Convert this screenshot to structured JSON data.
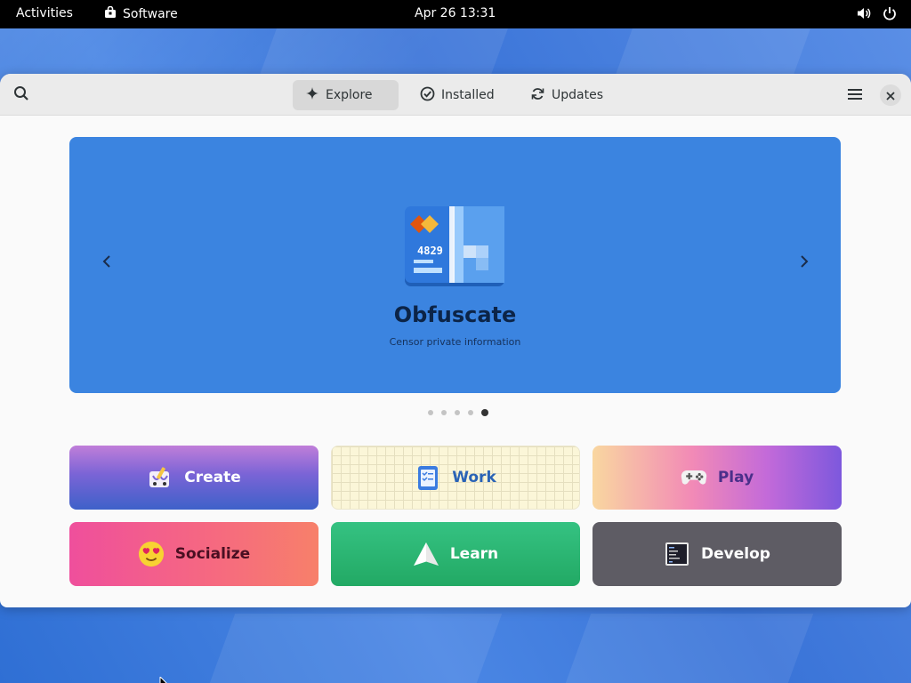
{
  "topbar": {
    "activities": "Activities",
    "app_name": "Software",
    "clock": "Apr 26  13:31",
    "icons": [
      "volume-icon",
      "power-icon"
    ]
  },
  "headerbar": {
    "tabs": [
      {
        "label": "Explore",
        "icon": "sparkle-icon",
        "active": true
      },
      {
        "label": "Installed",
        "icon": "check-circle-icon",
        "active": false
      },
      {
        "label": "Updates",
        "icon": "refresh-icon",
        "active": false
      }
    ],
    "icons": [
      "search-icon",
      "hamburger-menu-icon",
      "close-icon"
    ]
  },
  "banner": {
    "app_name": "Obfuscate",
    "app_description": "Censor private information",
    "icon_text": "4829",
    "background": "#3b84e0",
    "carousel": {
      "pages": 5,
      "active_page": 5
    }
  },
  "categories": [
    {
      "label": "Create",
      "icon": "create-icon"
    },
    {
      "label": "Work",
      "icon": "work-icon"
    },
    {
      "label": "Play",
      "icon": "gamepad-icon"
    },
    {
      "label": "Socialize",
      "icon": "emoji-icon"
    },
    {
      "label": "Learn",
      "icon": "paper-plane-icon"
    },
    {
      "label": "Develop",
      "icon": "terminal-icon"
    }
  ]
}
